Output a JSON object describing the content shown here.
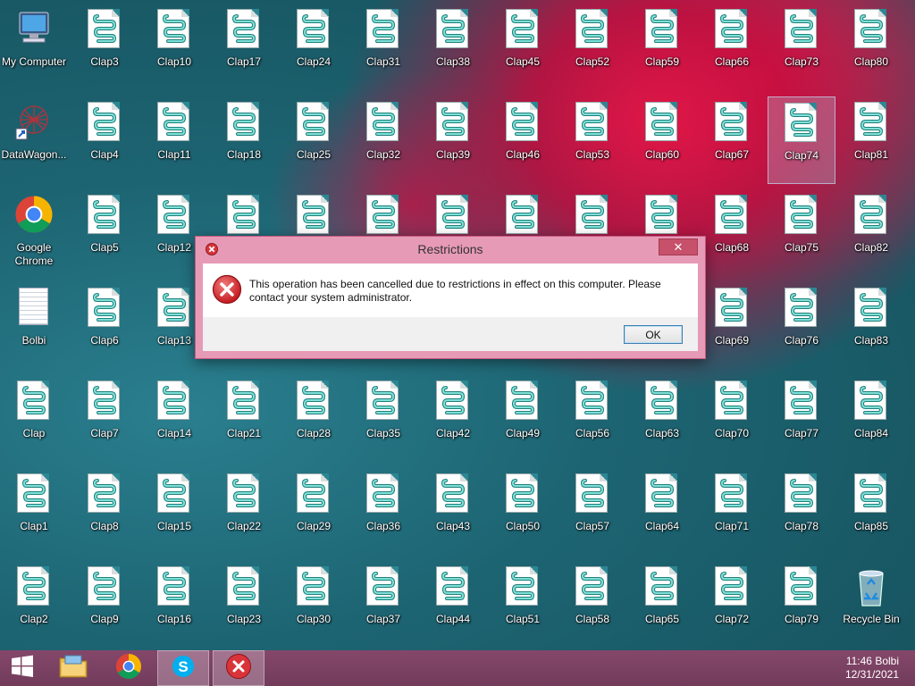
{
  "desktop": {
    "icons": [
      {
        "label": "My Computer",
        "type": "computer"
      },
      {
        "label": "DataWagon...",
        "type": "datawagon"
      },
      {
        "label": "Google Chrome",
        "type": "chrome"
      },
      {
        "label": "Bolbi",
        "type": "textdoc"
      },
      {
        "label": "Clap",
        "type": "scroll"
      },
      {
        "label": "Clap1",
        "type": "scroll"
      },
      {
        "label": "Clap2",
        "type": "scroll"
      },
      {
        "label": "Clap3",
        "type": "scroll"
      },
      {
        "label": "Clap4",
        "type": "scroll"
      },
      {
        "label": "Clap5",
        "type": "scroll"
      },
      {
        "label": "Clap6",
        "type": "scroll"
      },
      {
        "label": "Clap7",
        "type": "scroll"
      },
      {
        "label": "Clap8",
        "type": "scroll"
      },
      {
        "label": "Clap9",
        "type": "scroll"
      },
      {
        "label": "Clap10",
        "type": "scroll"
      },
      {
        "label": "Clap11",
        "type": "scroll"
      },
      {
        "label": "Clap12",
        "type": "scroll"
      },
      {
        "label": "Clap13",
        "type": "scroll"
      },
      {
        "label": "Clap14",
        "type": "scroll"
      },
      {
        "label": "Clap15",
        "type": "scroll"
      },
      {
        "label": "Clap16",
        "type": "scroll"
      },
      {
        "label": "Clap17",
        "type": "scroll"
      },
      {
        "label": "Clap18",
        "type": "scroll"
      },
      {
        "label": "",
        "type": "scroll"
      },
      {
        "label": "",
        "type": "scroll"
      },
      {
        "label": "Clap21",
        "type": "scroll"
      },
      {
        "label": "Clap22",
        "type": "scroll"
      },
      {
        "label": "Clap23",
        "type": "scroll"
      },
      {
        "label": "Clap24",
        "type": "scroll"
      },
      {
        "label": "Clap25",
        "type": "scroll"
      },
      {
        "label": "",
        "type": "scroll"
      },
      {
        "label": "",
        "type": "scroll"
      },
      {
        "label": "Clap28",
        "type": "scroll"
      },
      {
        "label": "Clap29",
        "type": "scroll"
      },
      {
        "label": "Clap30",
        "type": "scroll"
      },
      {
        "label": "Clap31",
        "type": "scroll"
      },
      {
        "label": "Clap32",
        "type": "scroll"
      },
      {
        "label": "",
        "type": "scroll"
      },
      {
        "label": "",
        "type": "scroll"
      },
      {
        "label": "Clap35",
        "type": "scroll"
      },
      {
        "label": "Clap36",
        "type": "scroll"
      },
      {
        "label": "Clap37",
        "type": "scroll"
      },
      {
        "label": "Clap38",
        "type": "scroll"
      },
      {
        "label": "Clap39",
        "type": "scroll"
      },
      {
        "label": "",
        "type": "scroll"
      },
      {
        "label": "",
        "type": "scroll"
      },
      {
        "label": "Clap42",
        "type": "scroll"
      },
      {
        "label": "Clap43",
        "type": "scroll"
      },
      {
        "label": "Clap44",
        "type": "scroll"
      },
      {
        "label": "Clap45",
        "type": "scroll"
      },
      {
        "label": "Clap46",
        "type": "scroll"
      },
      {
        "label": "",
        "type": "scroll"
      },
      {
        "label": "",
        "type": "scroll"
      },
      {
        "label": "Clap49",
        "type": "scroll"
      },
      {
        "label": "Clap50",
        "type": "scroll"
      },
      {
        "label": "Clap51",
        "type": "scroll"
      },
      {
        "label": "Clap52",
        "type": "scroll"
      },
      {
        "label": "Clap53",
        "type": "scroll"
      },
      {
        "label": "",
        "type": "scroll"
      },
      {
        "label": "",
        "type": "scroll"
      },
      {
        "label": "Clap56",
        "type": "scroll"
      },
      {
        "label": "Clap57",
        "type": "scroll"
      },
      {
        "label": "Clap58",
        "type": "scroll"
      },
      {
        "label": "Clap59",
        "type": "scroll"
      },
      {
        "label": "Clap60",
        "type": "scroll"
      },
      {
        "label": "",
        "type": "scroll"
      },
      {
        "label": "",
        "type": "scroll"
      },
      {
        "label": "Clap63",
        "type": "scroll"
      },
      {
        "label": "Clap64",
        "type": "scroll"
      },
      {
        "label": "Clap65",
        "type": "scroll"
      },
      {
        "label": "Clap66",
        "type": "scroll"
      },
      {
        "label": "Clap67",
        "type": "scroll"
      },
      {
        "label": "Clap68",
        "type": "scroll"
      },
      {
        "label": "Clap69",
        "type": "scroll"
      },
      {
        "label": "Clap70",
        "type": "scroll"
      },
      {
        "label": "Clap71",
        "type": "scroll"
      },
      {
        "label": "Clap72",
        "type": "scroll"
      },
      {
        "label": "Clap73",
        "type": "scroll"
      },
      {
        "label": "Clap74",
        "type": "scroll",
        "selected": true
      },
      {
        "label": "Clap75",
        "type": "scroll"
      },
      {
        "label": "Clap76",
        "type": "scroll"
      },
      {
        "label": "Clap77",
        "type": "scroll"
      },
      {
        "label": "Clap78",
        "type": "scroll"
      },
      {
        "label": "Clap79",
        "type": "scroll"
      },
      {
        "label": "Clap80",
        "type": "scroll"
      },
      {
        "label": "Clap81",
        "type": "scroll"
      },
      {
        "label": "Clap82",
        "type": "scroll"
      },
      {
        "label": "Clap83",
        "type": "scroll"
      },
      {
        "label": "Clap84",
        "type": "scroll"
      },
      {
        "label": "Clap85",
        "type": "scroll"
      },
      {
        "label": "Recycle Bin",
        "type": "recycle"
      }
    ]
  },
  "dialog": {
    "title": "Restrictions",
    "close_label": "✕",
    "message": "This operation has been cancelled due to restrictions in effect on this computer. Please contact your system administrator.",
    "ok_label": "OK"
  },
  "taskbar": {
    "clock_time": "11:46 Bolbi",
    "clock_date": "12/31/2021"
  },
  "colors": {
    "taskbar": "#7a4062",
    "dialog_frame": "#e79ab6",
    "error_red": "#d9343a",
    "scroll_teal": "#2aa6a0"
  }
}
